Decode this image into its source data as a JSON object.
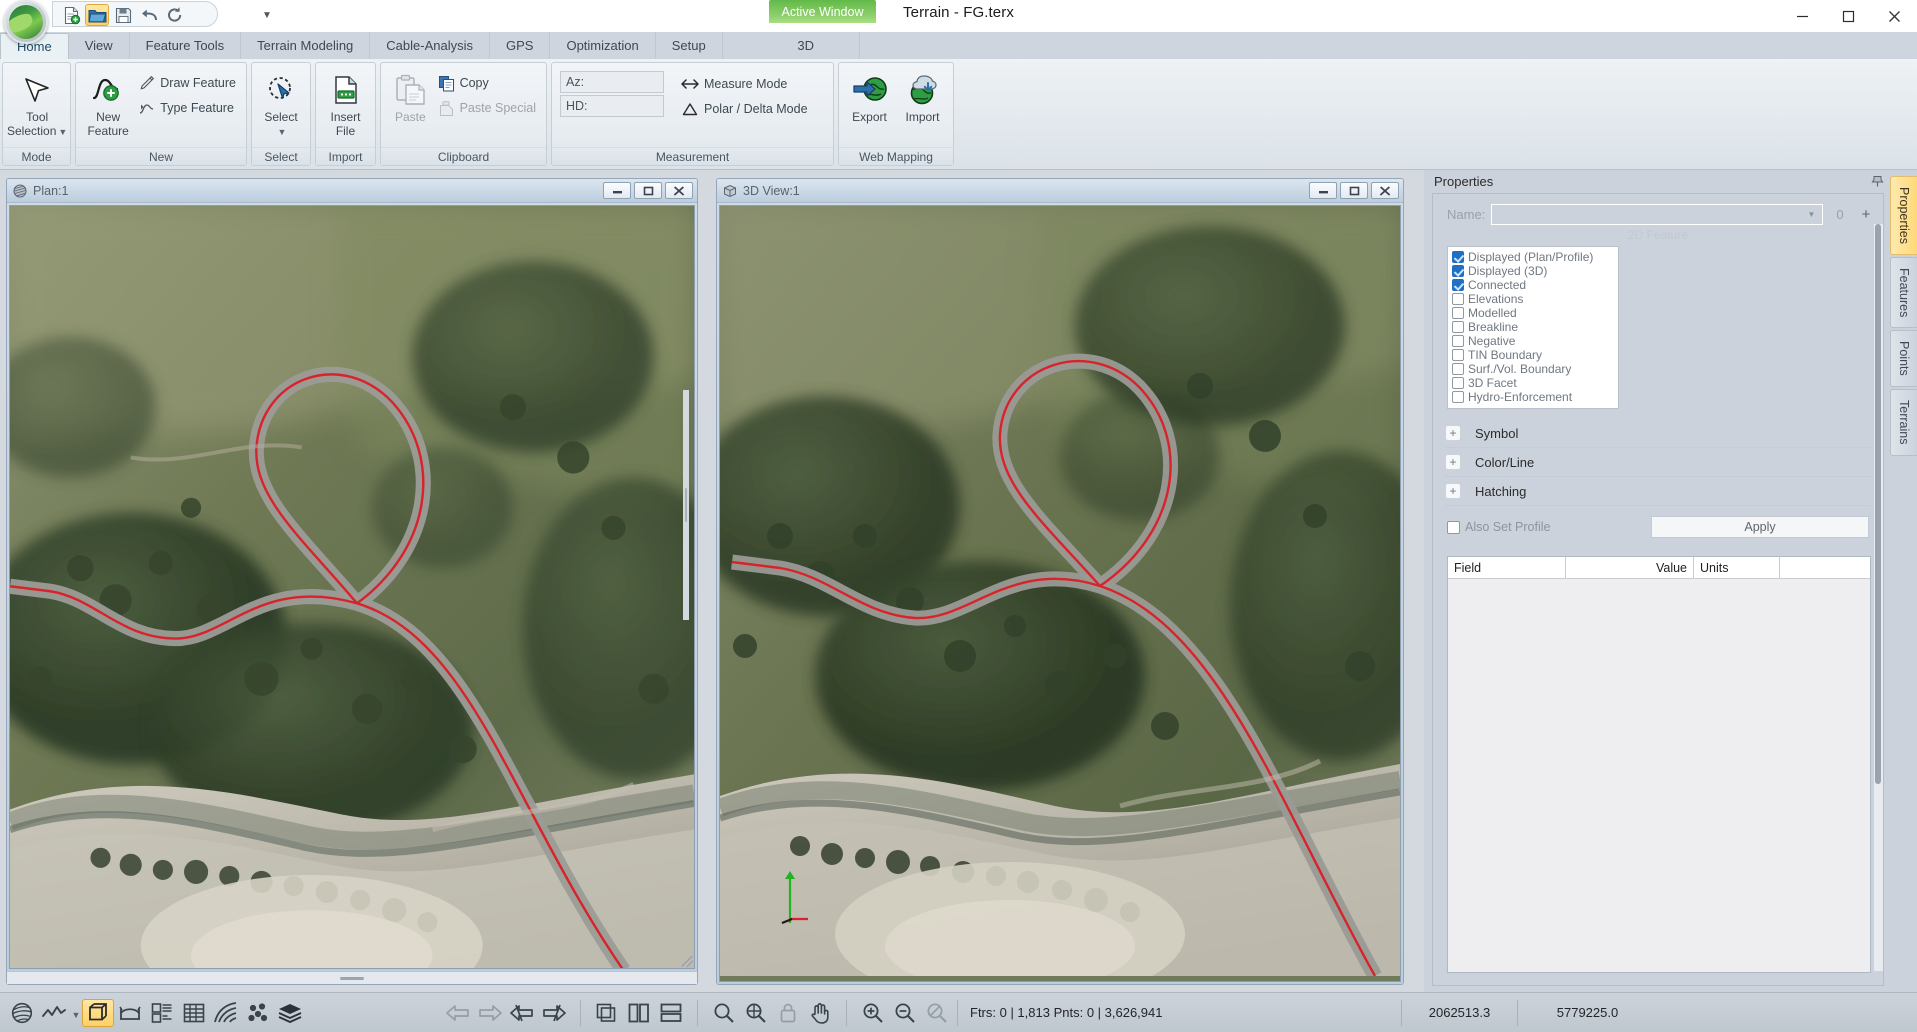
{
  "window": {
    "title": "Terrain - FG.terx",
    "minimize_label": "Minimize",
    "maximize_label": "Maximize",
    "close_label": "Close"
  },
  "quick_access": {
    "new_label": "New",
    "open_label": "Open",
    "save_label": "Save",
    "undo_label": "Undo",
    "redo_label": "Redo",
    "customize_label": "Customize Quick Access Toolbar"
  },
  "ribbon": {
    "active_window_badge": "Active Window",
    "tabs": [
      {
        "label": "Home",
        "active": true
      },
      {
        "label": "View",
        "active": false
      },
      {
        "label": "Feature Tools",
        "active": false
      },
      {
        "label": "Terrain Modeling",
        "active": false
      },
      {
        "label": "Cable-Analysis",
        "active": false
      },
      {
        "label": "GPS",
        "active": false
      },
      {
        "label": "Optimization",
        "active": false
      },
      {
        "label": "Setup",
        "active": false
      },
      {
        "label": "3D",
        "active": false
      }
    ],
    "groups": {
      "mode": {
        "title": "Mode",
        "tool_selection_line1": "Tool",
        "tool_selection_line2": "Selection"
      },
      "new": {
        "title": "New",
        "new_feature_line1": "New",
        "new_feature_line2": "Feature",
        "draw_feature": "Draw Feature",
        "type_feature": "Type Feature"
      },
      "select": {
        "title": "Select",
        "select_label": "Select"
      },
      "import": {
        "title": "Import",
        "insert_file_line1": "Insert",
        "insert_file_line2": "File"
      },
      "clipboard": {
        "title": "Clipboard",
        "paste": "Paste",
        "copy": "Copy",
        "paste_special": "Paste Special"
      },
      "measurement": {
        "title": "Measurement",
        "az_label": "Az:",
        "az_value": "",
        "hd_label": "HD:",
        "hd_value": "",
        "measure_mode": "Measure Mode",
        "polar_delta_mode": "Polar / Delta Mode"
      },
      "web_mapping": {
        "title": "Web Mapping",
        "export": "Export",
        "import": "Import"
      }
    }
  },
  "views": {
    "plan": {
      "title": "Plan:1"
    },
    "three_d": {
      "title": "3D View:1"
    }
  },
  "properties": {
    "panel_title": "Properties",
    "name_label": "Name:",
    "name_value": "",
    "name_spin_value": "0",
    "add_button_label": "+",
    "feature_caption": "2D Feature",
    "checkboxes": [
      {
        "label": "Displayed (Plan/Profile)",
        "checked": true
      },
      {
        "label": "Displayed (3D)",
        "checked": true
      },
      {
        "label": "Connected",
        "checked": true
      },
      {
        "label": "Elevations",
        "checked": false
      },
      {
        "label": "Modelled",
        "checked": false
      },
      {
        "label": "Breakline",
        "checked": false
      },
      {
        "label": "Negative",
        "checked": false
      },
      {
        "label": "TIN Boundary",
        "checked": false
      },
      {
        "label": "Surf./Vol. Boundary",
        "checked": false
      },
      {
        "label": "3D Facet",
        "checked": false
      },
      {
        "label": "Hydro-Enforcement",
        "checked": false
      }
    ],
    "sections": [
      {
        "label": "Symbol",
        "expander": "+"
      },
      {
        "label": "Color/Line",
        "expander": "+"
      },
      {
        "label": "Hatching",
        "expander": "+"
      }
    ],
    "also_set_profile": "Also Set Profile",
    "also_set_profile_checked": false,
    "apply_label": "Apply",
    "grid_headers": [
      "Field",
      "Value",
      "Units",
      ""
    ],
    "grid_rows": []
  },
  "side_tabs": [
    {
      "label": "Properties",
      "active": true
    },
    {
      "label": "Features",
      "active": false
    },
    {
      "label": "Points",
      "active": false
    },
    {
      "label": "Terrains",
      "active": false
    }
  ],
  "statusbar": {
    "tools_left": [
      {
        "name": "terrain-surface-icon",
        "label": "Terrain Surface",
        "state": "normal"
      },
      {
        "name": "profile-icon",
        "label": "Profile",
        "state": "normal"
      },
      {
        "name": "view-dropdown-caret",
        "label": "More Views",
        "state": "normal"
      },
      {
        "name": "3d-view-icon",
        "label": "3D View",
        "state": "active"
      },
      {
        "name": "cross-section-icon",
        "label": "Cross Section",
        "state": "normal"
      },
      {
        "name": "report-icon",
        "label": "Report",
        "state": "normal"
      },
      {
        "name": "table-icon",
        "label": "Table",
        "state": "normal"
      },
      {
        "name": "contours-icon",
        "label": "Contours",
        "state": "normal"
      },
      {
        "name": "points-icon",
        "label": "Points",
        "state": "normal"
      },
      {
        "name": "layers-icon",
        "label": "Layers",
        "state": "normal"
      }
    ],
    "tools_nav": [
      {
        "name": "back-icon",
        "label": "Back",
        "state": "disabled"
      },
      {
        "name": "forward-icon",
        "label": "Forward",
        "state": "disabled"
      },
      {
        "name": "undo-view-icon",
        "label": "Previous View",
        "state": "normal"
      },
      {
        "name": "redo-view-icon",
        "label": "Next View",
        "state": "normal"
      }
    ],
    "tools_window": [
      {
        "name": "cascade-icon",
        "label": "Cascade Windows",
        "state": "normal"
      },
      {
        "name": "tile-vertical-icon",
        "label": "Tile Vertically",
        "state": "normal"
      },
      {
        "name": "tile-horizontal-icon",
        "label": "Tile Horizontally",
        "state": "normal"
      }
    ],
    "tools_zoom": [
      {
        "name": "zoom-window-icon",
        "label": "Zoom Window",
        "state": "normal"
      },
      {
        "name": "zoom-extents-icon",
        "label": "Zoom Extents",
        "state": "normal"
      },
      {
        "name": "lock-icon",
        "label": "Lock View",
        "state": "disabled"
      },
      {
        "name": "pan-icon",
        "label": "Pan",
        "state": "normal"
      }
    ],
    "tools_zoom2": [
      {
        "name": "zoom-in-icon",
        "label": "Zoom In",
        "state": "normal"
      },
      {
        "name": "zoom-out-icon",
        "label": "Zoom Out",
        "state": "normal"
      },
      {
        "name": "zoom-none-icon",
        "label": "No Zoom",
        "state": "disabled"
      }
    ],
    "counts": "Ftrs: 0 | 1,813  Pnts: 0 | 3,626,941",
    "coord_x": "2062513.3",
    "coord_y": "5779225.0"
  },
  "colors": {
    "accent_green": "#7ec94f",
    "highlight_orange": "#ffd163",
    "checkbox_blue": "#1f6fc4",
    "feature_line_red": "#d8232a",
    "chrome": "#ccd2dc"
  }
}
